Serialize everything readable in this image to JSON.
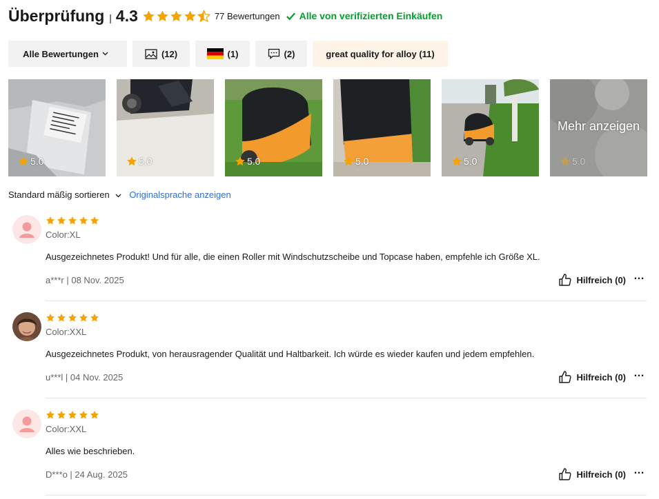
{
  "header": {
    "title": "Überprüfung",
    "separator": "|",
    "rating": "4.3",
    "count": "77 Bewertungen",
    "verified": "Alle von verifizierten Einkäufen"
  },
  "colors": {
    "star": "#f5a300",
    "verified": "#00a12c",
    "link": "#2e6fd8"
  },
  "filters": [
    {
      "label": "Alle Bewertungen",
      "icon": "chevron-down-icon"
    },
    {
      "label": "(12)",
      "icon": "image-icon"
    },
    {
      "label": "(1)",
      "icon": "germany-flag-icon"
    },
    {
      "label": "(2)",
      "icon": "comment-icon"
    },
    {
      "label": "great quality for alloy (11)"
    }
  ],
  "photos": [
    {
      "rating": "5.0"
    },
    {
      "rating": "5.0"
    },
    {
      "rating": "5.0"
    },
    {
      "rating": "5.0"
    },
    {
      "rating": "5.0"
    },
    {
      "rating": "5.0",
      "overlay": "Mehr anzeigen"
    }
  ],
  "sort": {
    "label": "Standard mäßig sortieren",
    "original": "Originalsprache anzeigen"
  },
  "reviews": [
    {
      "color": "Color:XL",
      "text": "Ausgezeichnetes Produkt! Und für alle, die einen Roller mit Windschutzscheibe und Topcase haben, empfehle ich Größe XL.",
      "meta": "a***r | 08 Nov. 2025",
      "helpful": "Hilfreich (0)",
      "stars": 5
    },
    {
      "color": "Color:XXL",
      "text": "Ausgezeichnetes Produkt, von herausragender Qualität und Haltbarkeit. Ich würde es wieder kaufen und jedem empfehlen.",
      "meta": "u***l | 04 Nov. 2025",
      "helpful": "Hilfreich (0)",
      "stars": 5
    },
    {
      "color": "Color:XXL",
      "text": "Alles wie beschrieben.",
      "meta": "D***o | 24 Aug. 2025",
      "helpful": "Hilfreich (0)",
      "stars": 5
    }
  ],
  "more_icon": "…"
}
